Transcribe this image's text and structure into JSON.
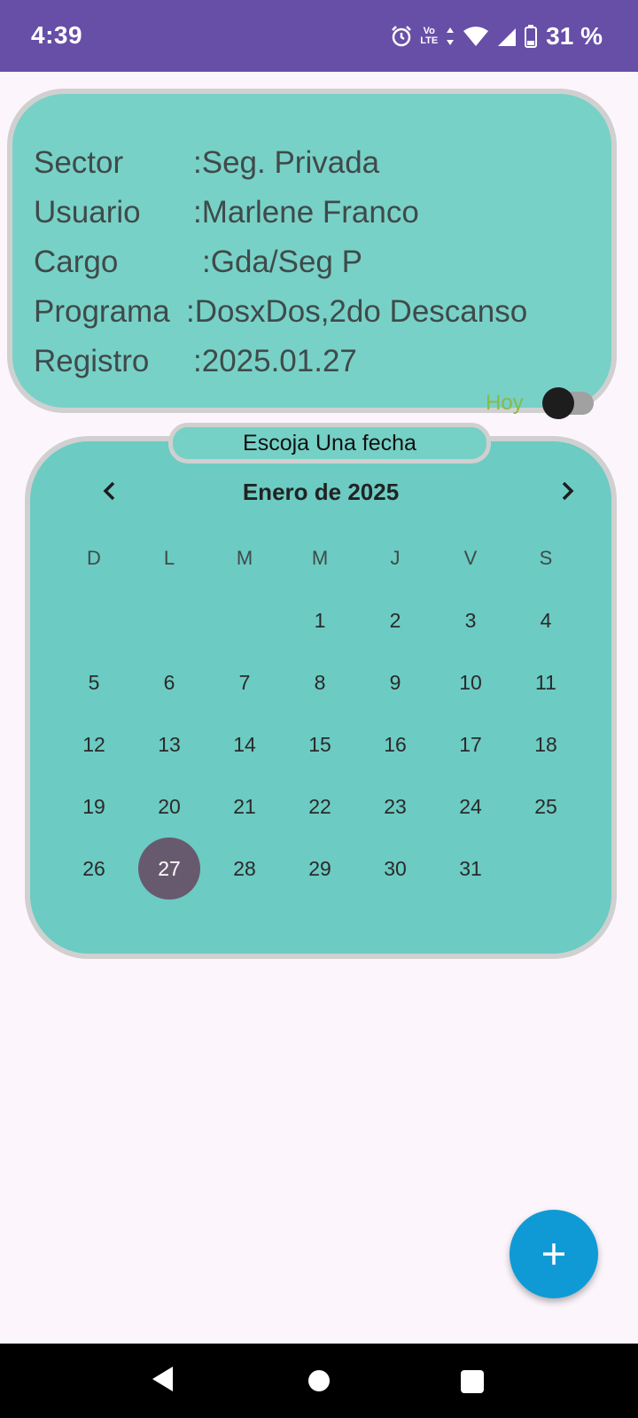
{
  "status_bar": {
    "time": "4:39",
    "volte_top": "Vo",
    "volte_bottom": "LTE",
    "battery": "31 %",
    "icons": [
      "alarm-icon",
      "volte-icon",
      "data-arrows-icon",
      "wifi-icon",
      "signal-icon",
      "battery-icon"
    ]
  },
  "info": {
    "rows": [
      {
        "label": "Sector",
        "value": ":Seg. Privada"
      },
      {
        "label": "Usuario",
        "value": ":Marlene Franco"
      },
      {
        "label": "Cargo",
        "value": ":Gda/Seg P"
      },
      {
        "label": "Programa",
        "value": ":DosxDos,2do Descanso"
      },
      {
        "label": "Registro",
        "value": ":2025.01.27"
      }
    ],
    "today_label": "Hoy",
    "today_switch_on": false
  },
  "calendar": {
    "header_label": "Escoja Una fecha",
    "month_title": "Enero de 2025",
    "weekdays": [
      "D",
      "L",
      "M",
      "M",
      "J",
      "V",
      "S"
    ],
    "first_weekday_index": 3,
    "days_in_month": 31,
    "selected_day": 27,
    "days": [
      "1",
      "2",
      "3",
      "4",
      "5",
      "6",
      "7",
      "8",
      "9",
      "10",
      "11",
      "12",
      "13",
      "14",
      "15",
      "16",
      "17",
      "18",
      "19",
      "20",
      "21",
      "22",
      "23",
      "24",
      "25",
      "26",
      "27",
      "28",
      "29",
      "30",
      "31"
    ]
  },
  "fab": {
    "icon": "plus-icon"
  },
  "nav_bar": {
    "icons": [
      "back-icon",
      "home-icon",
      "recents-icon"
    ]
  },
  "colors": {
    "status_bar": "#674ea7",
    "card": "#78d1c7",
    "calendar": "#6ccbc3",
    "selected_day": "#685a6e",
    "fab": "#0f9ad6",
    "today_label": "#8ab94a"
  }
}
